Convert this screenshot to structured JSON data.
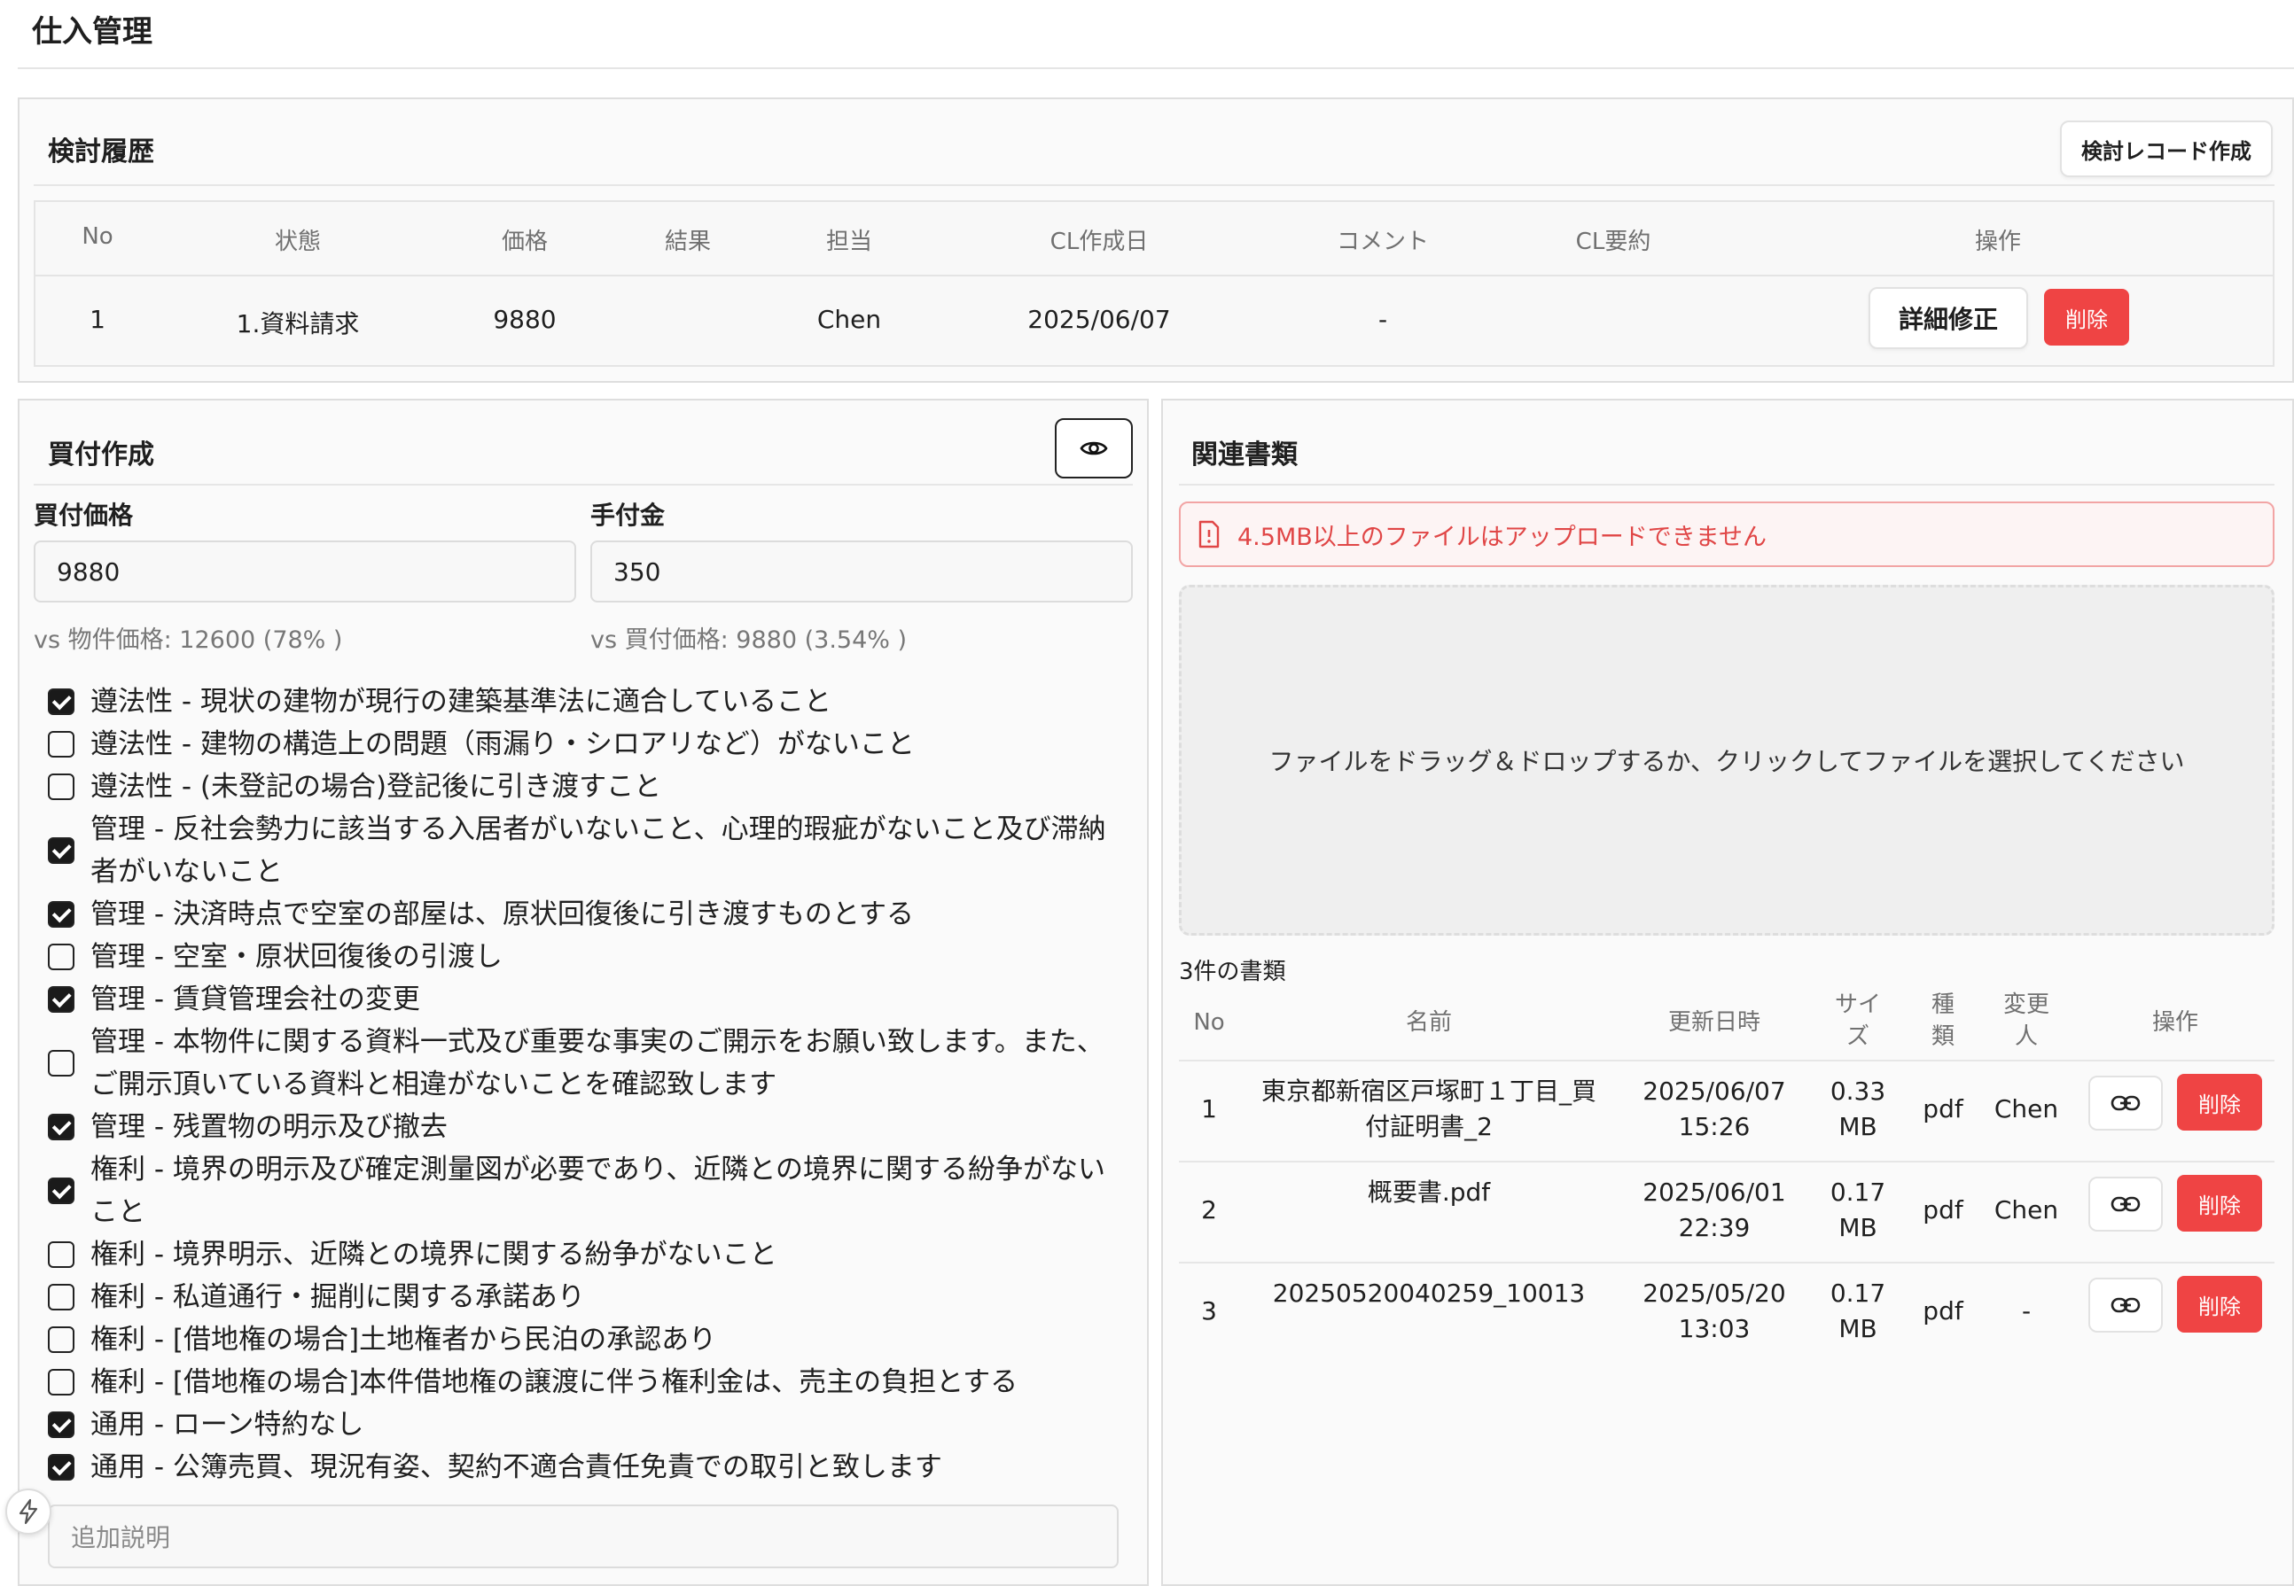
{
  "page_title": "仕入管理",
  "review": {
    "title": "検討履歴",
    "create_button": "検討レコード作成",
    "headers": [
      "No",
      "状態",
      "価格",
      "結果",
      "担当",
      "CL作成日",
      "コメント",
      "CL要約",
      "操作"
    ],
    "rows": [
      {
        "no": "1",
        "status": "1.資料請求",
        "price": "9880",
        "result": "",
        "assignee": "Chen",
        "cl_date": "2025/06/07",
        "comment": "-",
        "cl_summary": "",
        "edit_label": "詳細修正",
        "delete_label": "削除"
      }
    ]
  },
  "purchase": {
    "title": "買付作成",
    "eye_icon": "eye-icon",
    "price_label": "買付価格",
    "price_value": "9880",
    "price_hint": "vs 物件価格: 12600 (78% )",
    "deposit_label": "手付金",
    "deposit_value": "350",
    "deposit_hint": "vs 買付価格: 9880 (3.54% )",
    "conditions": [
      {
        "checked": true,
        "text": "遵法性 - 現状の建物が現行の建築基準法に適合していること"
      },
      {
        "checked": false,
        "text": "遵法性 - 建物の構造上の問題（雨漏り・シロアリなど）がないこと"
      },
      {
        "checked": false,
        "text": "遵法性 - (未登記の場合)登記後に引き渡すこと"
      },
      {
        "checked": true,
        "text": "管理 - 反社会勢力に該当する入居者がいないこと、心理的瑕疵がないこと及び滞納者がいないこと"
      },
      {
        "checked": true,
        "text": "管理 - 決済時点で空室の部屋は、原状回復後に引き渡すものとする"
      },
      {
        "checked": false,
        "text": "管理 - 空室・原状回復後の引渡し"
      },
      {
        "checked": true,
        "text": "管理 - 賃貸管理会社の変更"
      },
      {
        "checked": false,
        "text": "管理 - 本物件に関する資料一式及び重要な事実のご開示をお願い致します。また、ご開示頂いている資料と相違がないことを確認致します"
      },
      {
        "checked": true,
        "text": "管理 - 残置物の明示及び撤去"
      },
      {
        "checked": true,
        "text": "権利 - 境界の明示及び確定測量図が必要であり、近隣との境界に関する紛争がないこと"
      },
      {
        "checked": false,
        "text": "権利 - 境界明示、近隣との境界に関する紛争がないこと"
      },
      {
        "checked": false,
        "text": "権利 - 私道通行・掘削に関する承諾あり"
      },
      {
        "checked": false,
        "text": "権利 - [借地権の場合]土地権者から民泊の承認あり"
      },
      {
        "checked": false,
        "text": "権利 - [借地権の場合]本件借地権の譲渡に伴う権利金は、売主の負担とする"
      },
      {
        "checked": true,
        "text": "通用 - ローン特約なし"
      },
      {
        "checked": true,
        "text": "通用 - 公簿売買、現況有姿、契約不適合責任免責での取引と致します"
      }
    ],
    "notes_placeholder": "追加説明"
  },
  "documents": {
    "title": "関連書類",
    "alert": "4.5MB以上のファイルはアップロードできません",
    "dropzone": "ファイルをドラッグ＆ドロップするか、クリックしてファイルを選択してください",
    "count_label": "3件の書類",
    "headers": [
      "No",
      "名前",
      "更新日時",
      "サイズ",
      "種類",
      "変更人",
      "操作"
    ],
    "rows": [
      {
        "no": "1",
        "name": "東京都新宿区戸塚町１丁目_買付証明書_2",
        "updated": "2025/06/07 15:26",
        "size": "0.33 MB",
        "type": "pdf",
        "changed_by": "Chen",
        "delete_label": "削除"
      },
      {
        "no": "2",
        "name": "概要書.pdf",
        "updated": "2025/06/01 22:39",
        "size": "0.17 MB",
        "type": "pdf",
        "changed_by": "Chen",
        "delete_label": "削除"
      },
      {
        "no": "3",
        "name": "20250520040259_10013",
        "updated": "2025/05/20 13:03",
        "size": "0.17 MB",
        "type": "pdf",
        "changed_by": "-",
        "delete_label": "削除"
      }
    ]
  },
  "colors": {
    "danger": "#ef4444",
    "panel_bg": "#fafafa",
    "border": "#dedede"
  }
}
